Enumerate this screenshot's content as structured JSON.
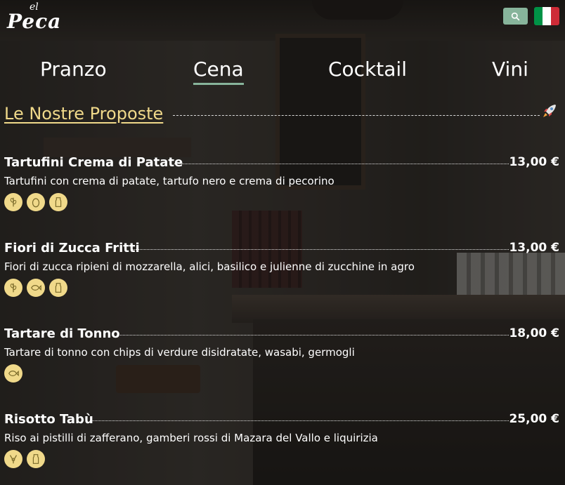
{
  "brand": {
    "small": "el",
    "name": "Peca"
  },
  "nav": {
    "items": [
      {
        "label": "Pranzo",
        "active": false
      },
      {
        "label": "Cena",
        "active": true
      },
      {
        "label": "Cocktail",
        "active": false
      },
      {
        "label": "Vini",
        "active": false
      }
    ]
  },
  "section": {
    "title": "Le Nostre Proposte",
    "icon": "rocket-icon"
  },
  "menu": [
    {
      "name": "Tartufini Crema di Patate",
      "price": "13,00 €",
      "description": "Tartufini con crema di patate, tartufo nero e crema di pecorino",
      "allergens": [
        "wheat-icon",
        "egg-icon",
        "milk-icon"
      ]
    },
    {
      "name": "Fiori di Zucca Fritti",
      "price": "13,00 €",
      "description": "Fiori di zucca ripieni di mozzarella, alici, basilico e julienne di zucchine in agro",
      "allergens": [
        "wheat-icon",
        "fish-icon",
        "milk-icon"
      ]
    },
    {
      "name": "Tartare di Tonno",
      "price": "18,00 €",
      "description": "Tartare di tonno con chips di verdure disidratate, wasabi, germogli",
      "allergens": [
        "fish-icon"
      ]
    },
    {
      "name": "Risotto Tabù",
      "price": "25,00 €",
      "description": "Riso ai pistilli di zafferano, gamberi rossi di Mazara del Vallo e liquirizia",
      "allergens": [
        "shellfish-icon",
        "milk-icon"
      ]
    }
  ],
  "colors": {
    "accent": "#87b49b",
    "section_title": "#f0d98a",
    "allergen_bg": "#f0d98a",
    "flag_green": "#009246",
    "flag_white": "#ffffff",
    "flag_red": "#ce2b37"
  }
}
